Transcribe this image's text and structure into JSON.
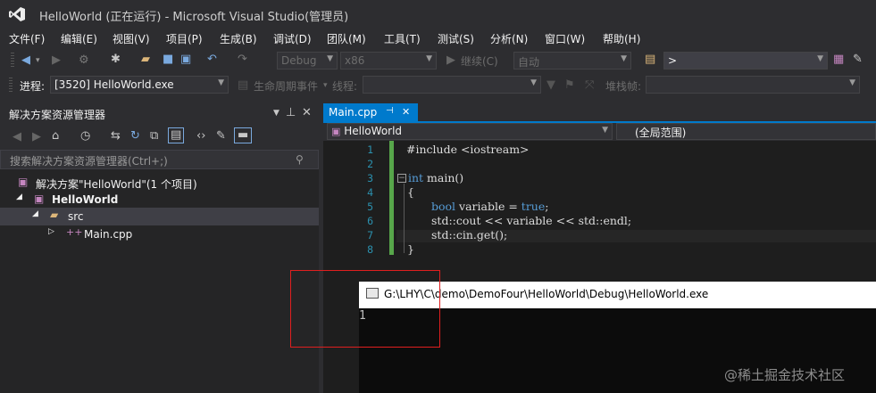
{
  "window": {
    "title": "HelloWorld (正在运行) - Microsoft Visual Studio(管理员)"
  },
  "menu": [
    "文件(F)",
    "编辑(E)",
    "视图(V)",
    "项目(P)",
    "生成(B)",
    "调试(D)",
    "团队(M)",
    "工具(T)",
    "测试(S)",
    "分析(N)",
    "窗口(W)",
    "帮助(H)"
  ],
  "toolbar": {
    "config": "Debug",
    "platform": "x86",
    "continue_label": "继续(C)",
    "auto_label": "自动",
    "find_value": ">"
  },
  "debug_bar": {
    "process_label": "进程:",
    "process_value": "[3520] HelloWorld.exe",
    "lifecycle_label": "生命周期事件",
    "thread_label": "线程:",
    "stack_label": "堆栈帧:"
  },
  "solution_explorer": {
    "title": "解决方案资源管理器",
    "search_placeholder": "搜索解决方案资源管理器(Ctrl+;)",
    "tree": {
      "solution": "解决方案\"HelloWorld\"(1 个项目)",
      "project": "HelloWorld",
      "folder": "src",
      "file": "Main.cpp"
    }
  },
  "editor": {
    "tab": "Main.cpp",
    "nav_left": "HelloWorld",
    "nav_right": "(全局范围)",
    "line_numbers": [
      "1",
      "2",
      "3",
      "4",
      "5",
      "6",
      "7",
      "8"
    ],
    "lines": {
      "l1": "#include <iostream>",
      "l3_kw": "int",
      "l3_rest": " main()",
      "l4": "{",
      "l5_kw1": "bool",
      "l5_mid": " variable = ",
      "l5_kw2": "true",
      "l5_end": ";",
      "l6": "std::cout << variable << std::endl;",
      "l7": "std::cin.get();",
      "l8": "}"
    }
  },
  "console": {
    "title": "G:\\LHY\\C\\demo\\DemoFour\\HelloWorld\\Debug\\HelloWorld.exe",
    "output": "1"
  },
  "watermark": "@稀土掘金技术社区",
  "colors": {
    "accent": "#007acc",
    "highlight_box": "#e01f1f"
  }
}
